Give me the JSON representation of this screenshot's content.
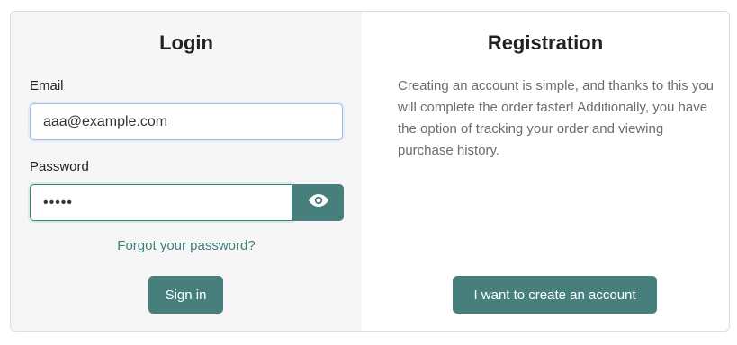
{
  "login": {
    "title": "Login",
    "email_label": "Email",
    "email_value": "aaa@example.com",
    "password_label": "Password",
    "password_value": "•••••",
    "show_password_icon": "eye-icon",
    "forgot_link": "Forgot your password?",
    "signin_button": "Sign in"
  },
  "registration": {
    "title": "Registration",
    "description": "Creating an account is simple, and thanks to this you will complete the order faster! Additionally, you have the option of tracking your order and viewing purchase history.",
    "create_button": "I want to create an account"
  },
  "colors": {
    "accent": "#467f7c",
    "link": "#3f7f7a",
    "login_panel_bg": "#f6f6f6"
  }
}
